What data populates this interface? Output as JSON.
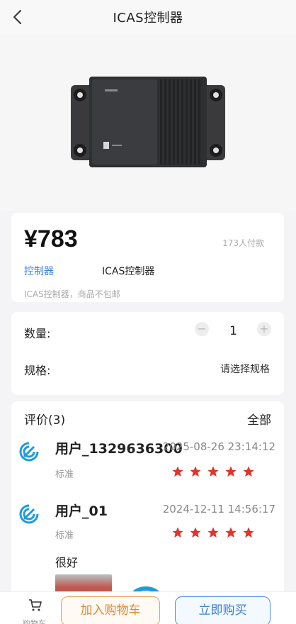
{
  "header": {
    "title": "ICAS控制器"
  },
  "product": {
    "price": "¥783",
    "paid_count": "173人付款",
    "category_link": "控制器",
    "category_name": "ICAS控制器",
    "description": "ICAS控制器，商品不包邮"
  },
  "purchase": {
    "quantity_label": "数量:",
    "minus": "−",
    "plus": "+",
    "quantity": "1",
    "spec_label": "规格:",
    "spec_select": "请选择规格"
  },
  "reviews": {
    "title": "评价(3)",
    "all_link": "全部",
    "items": [
      {
        "user": "用户_1329636300",
        "date": "2025-08-26 23:14:12",
        "tag": "标准",
        "rating": 5,
        "text": ""
      },
      {
        "user": "用户_01",
        "date": "2024-12-11 14:56:17",
        "tag": "标准",
        "rating": 5,
        "text": "很好"
      }
    ]
  },
  "bottom_bar": {
    "cart_label": "购物车",
    "add_to_cart": "加入购物车",
    "buy_now": "立即购买"
  },
  "colors": {
    "accent_blue": "#3b82f6",
    "star_red": "#e5332a",
    "cart_orange": "#e0892b"
  },
  "icons": [
    "back-icon",
    "avatar-logo-icon",
    "star-icon",
    "cart-icon"
  ]
}
